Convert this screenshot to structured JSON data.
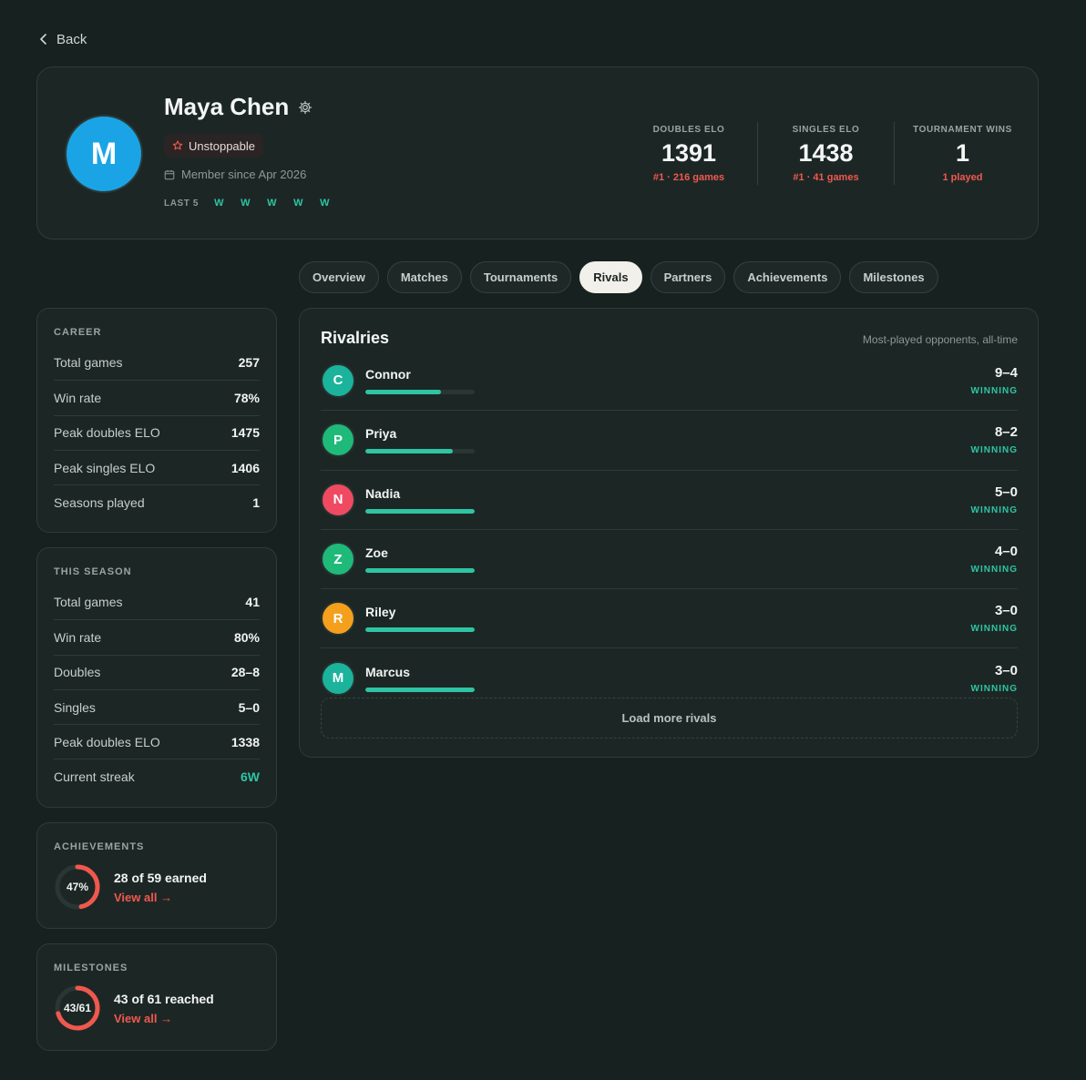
{
  "nav": {
    "back_label": "Back"
  },
  "profile": {
    "avatar_initial": "M",
    "avatar_color": "#1aa4e6",
    "name": "Maya Chen",
    "badge": "Unstoppable",
    "member_since": "Member since Apr 2026",
    "last5_label": "LAST 5",
    "last5": [
      "W",
      "W",
      "W",
      "W",
      "W"
    ],
    "stats": [
      {
        "label": "DOUBLES ELO",
        "value": "1391",
        "sub": "#1 · 216 games"
      },
      {
        "label": "SINGLES ELO",
        "value": "1438",
        "sub": "#1 · 41 games"
      },
      {
        "label": "TOURNAMENT WINS",
        "value": "1",
        "sub": "1 played"
      }
    ]
  },
  "tabs": [
    {
      "label": "Overview",
      "active": false
    },
    {
      "label": "Matches",
      "active": false
    },
    {
      "label": "Tournaments",
      "active": false
    },
    {
      "label": "Rivals",
      "active": true
    },
    {
      "label": "Partners",
      "active": false
    },
    {
      "label": "Achievements",
      "active": false
    },
    {
      "label": "Milestones",
      "active": false
    }
  ],
  "career": {
    "title": "CAREER",
    "rows": [
      {
        "label": "Total games",
        "value": "257"
      },
      {
        "label": "Win rate",
        "value": "78%"
      },
      {
        "label": "Peak doubles ELO",
        "value": "1475"
      },
      {
        "label": "Peak singles ELO",
        "value": "1406"
      },
      {
        "label": "Seasons played",
        "value": "1"
      }
    ]
  },
  "season": {
    "title": "THIS SEASON",
    "rows": [
      {
        "label": "Total games",
        "value": "41"
      },
      {
        "label": "Win rate",
        "value": "80%"
      },
      {
        "label": "Doubles",
        "value": "28–8"
      },
      {
        "label": "Singles",
        "value": "5–0"
      },
      {
        "label": "Peak doubles ELO",
        "value": "1338"
      },
      {
        "label": "Current streak",
        "value": "6W"
      }
    ]
  },
  "achievements": {
    "title": "ACHIEVEMENTS",
    "ring_label": "47%",
    "progress": 0.47,
    "text": "28 of 59 earned",
    "link": "View all →"
  },
  "milestones": {
    "title": "MILESTONES",
    "ring_label": "43/61",
    "progress": 0.705,
    "text": "43 of 61 reached",
    "link": "View all →"
  },
  "rivals": {
    "title": "Rivalries",
    "subtitle": "Most-played opponents, all-time",
    "load_more": "Load more rivals",
    "items": [
      {
        "initial": "C",
        "name": "Connor",
        "color": "#1bb39b",
        "record": "9–4",
        "status": "WINNING",
        "win_share": 0.69
      },
      {
        "initial": "P",
        "name": "Priya",
        "color": "#1fb97a",
        "record": "8–2",
        "status": "WINNING",
        "win_share": 0.8
      },
      {
        "initial": "N",
        "name": "Nadia",
        "color": "#ef4a62",
        "record": "5–0",
        "status": "WINNING",
        "win_share": 1.0
      },
      {
        "initial": "Z",
        "name": "Zoe",
        "color": "#1fb97a",
        "record": "4–0",
        "status": "WINNING",
        "win_share": 1.0
      },
      {
        "initial": "R",
        "name": "Riley",
        "color": "#f4a01c",
        "record": "3–0",
        "status": "WINNING",
        "win_share": 1.0
      },
      {
        "initial": "M",
        "name": "Marcus",
        "color": "#1bb39b",
        "record": "3–0",
        "status": "WINNING",
        "win_share": 1.0
      }
    ]
  }
}
